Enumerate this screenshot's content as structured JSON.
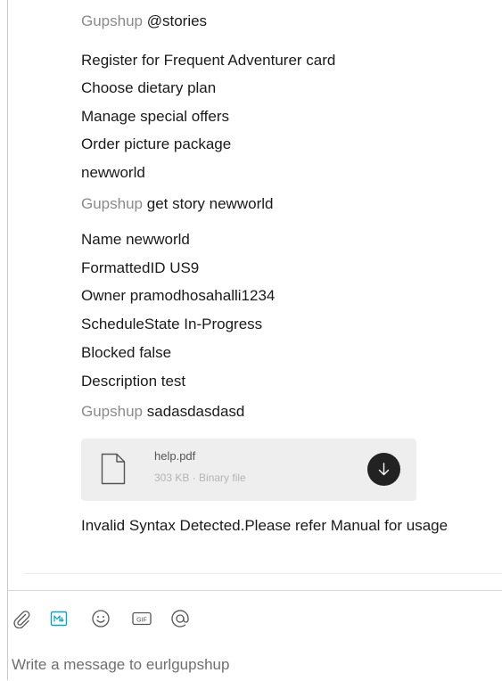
{
  "messages": {
    "m1": {
      "sender": "Gupshup",
      "text": "@stories"
    },
    "options": [
      "Register for Frequent Adventurer card",
      "Choose dietary plan",
      "Manage special offers",
      "Order picture package",
      "newworld"
    ],
    "m2": {
      "sender": "Gupshup",
      "text": "get story newworld"
    },
    "story_fields": [
      "Name  newworld",
      "FormattedID  US9",
      "Owner  pramodhosahalli1234",
      "ScheduleState  In-Progress",
      "Blocked  false",
      "Description  test"
    ],
    "m3": {
      "sender": "Gupshup",
      "text": "sadasdasdasd"
    },
    "attachment": {
      "name": "help.pdf",
      "meta": "303 KB · Binary file",
      "icon": "file-icon",
      "download_icon": "download-arrow-icon"
    },
    "error_text": "Invalid Syntax Detected.Please refer Manual for usage"
  },
  "composer": {
    "tools": [
      "paperclip-icon",
      "markdown-icon",
      "smiley-icon",
      "gif-icon",
      "mention-icon"
    ],
    "placeholder": "Write a message to eurlgupshup",
    "accent_color": "#07a3cd"
  }
}
